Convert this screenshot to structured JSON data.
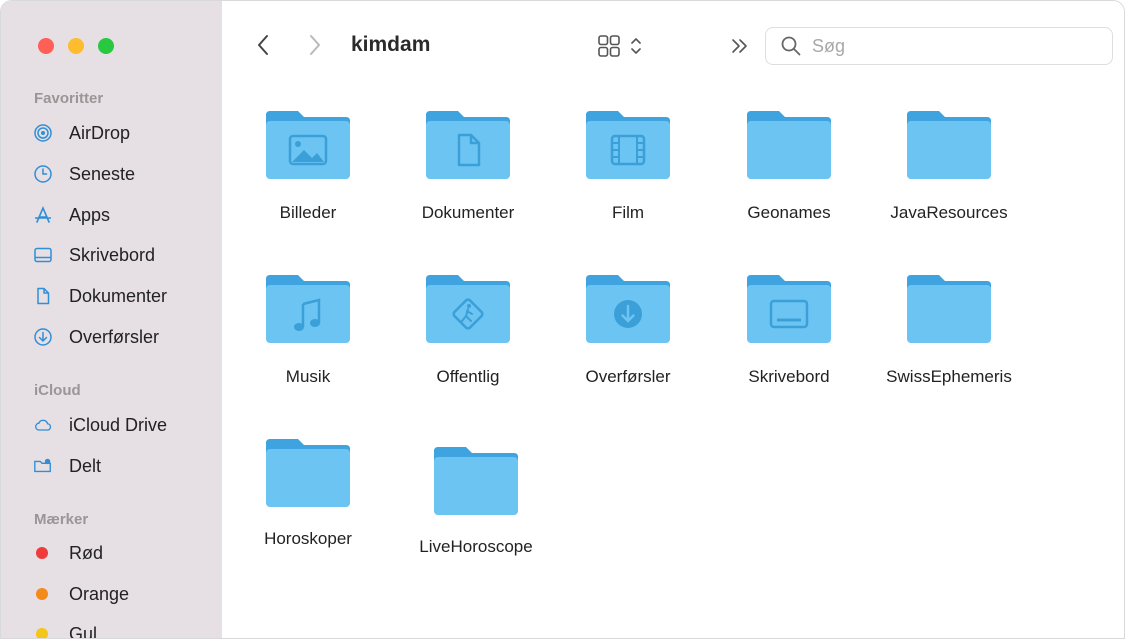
{
  "window": {
    "title": "kimdam"
  },
  "sidebar": {
    "sections": [
      {
        "title": "Favoritter"
      },
      {
        "title": "iCloud"
      },
      {
        "title": "Mærker"
      }
    ],
    "favorites": [
      {
        "label": "AirDrop",
        "icon": "airdrop-icon"
      },
      {
        "label": "Seneste",
        "icon": "clock-icon"
      },
      {
        "label": "Apps",
        "icon": "apps-icon"
      },
      {
        "label": "Skrivebord",
        "icon": "desktop-icon"
      },
      {
        "label": "Dokumenter",
        "icon": "document-icon"
      },
      {
        "label": "Overførsler",
        "icon": "download-icon"
      }
    ],
    "icloud": [
      {
        "label": "iCloud Drive",
        "icon": "cloud-icon"
      },
      {
        "label": "Delt",
        "icon": "shared-folder-icon"
      }
    ],
    "tags": [
      {
        "label": "Rød",
        "color": "#f03b3b"
      },
      {
        "label": "Orange",
        "color": "#f28b1a"
      },
      {
        "label": "Gul",
        "color": "#f5c518"
      }
    ]
  },
  "toolbar": {
    "search_placeholder": "Søg"
  },
  "files": [
    {
      "label": "Billeder",
      "glyph": "photo"
    },
    {
      "label": "Dokumenter",
      "glyph": "document"
    },
    {
      "label": "Film",
      "glyph": "film"
    },
    {
      "label": "Geonames",
      "glyph": ""
    },
    {
      "label": "JavaResources",
      "glyph": ""
    },
    {
      "label": "Musik",
      "glyph": "music"
    },
    {
      "label": "Offentlig",
      "glyph": "public"
    },
    {
      "label": "Overførsler",
      "glyph": "download"
    },
    {
      "label": "Skrivebord",
      "glyph": "desktop"
    },
    {
      "label": "SwissEphemeris",
      "glyph": ""
    },
    {
      "label": "Horoskoper",
      "glyph": ""
    },
    {
      "label": "LiveHoroscope",
      "glyph": ""
    }
  ],
  "colors": {
    "folder_body": "#6cc4f3",
    "folder_tab": "#3ea3de",
    "sidebar_bg": "#e6dfe3",
    "accent": "#2f8fd8"
  }
}
